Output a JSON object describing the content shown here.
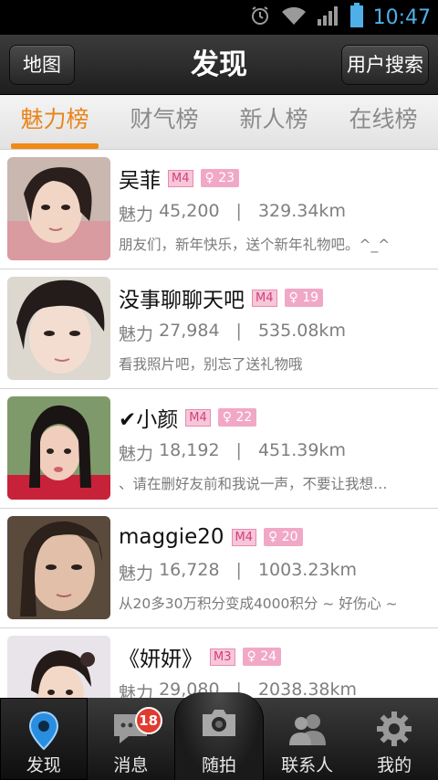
{
  "status_bar": {
    "time": "10:47"
  },
  "titlebar": {
    "title": "发现",
    "left_button": "地图",
    "right_button": "用户搜索"
  },
  "tabs": [
    {
      "label": "魅力榜",
      "active": true
    },
    {
      "label": "财气榜",
      "active": false
    },
    {
      "label": "新人榜",
      "active": false
    },
    {
      "label": "在线榜",
      "active": false
    }
  ],
  "users": [
    {
      "name": "吴菲",
      "level": "M4",
      "age": "23",
      "charm_label": "魅力",
      "charm": "45,200",
      "distance": "329.34km",
      "message": "朋友们，新年快乐，送个新年礼物吧。^_^"
    },
    {
      "name": "没事聊聊天吧",
      "level": "M4",
      "age": "19",
      "charm_label": "魅力",
      "charm": "27,984",
      "distance": "535.08km",
      "message": "看我照片吧，别忘了送礼物哦"
    },
    {
      "name": "✔小颜",
      "level": "M4",
      "age": "22",
      "charm_label": "魅力",
      "charm": "18,192",
      "distance": "451.39km",
      "message": "、请在删好友前和我说一声，不要让我想…"
    },
    {
      "name": "maggie20",
      "level": "M4",
      "age": "20",
      "charm_label": "魅力",
      "charm": "16,728",
      "distance": "1003.23km",
      "message": "从20多30万积分变成4000积分 ~ 好伤心 ~"
    },
    {
      "name": "《妍妍》",
      "level": "M3",
      "age": "24",
      "charm_label": "魅力",
      "charm": "29,080",
      "distance": "2038.38km",
      "message": ""
    }
  ],
  "bottom_nav": {
    "discover": "发现",
    "messages": "消息",
    "messages_badge": "18",
    "snap": "随拍",
    "contacts": "联系人",
    "mine": "我的"
  },
  "colors": {
    "accent": "#f08a14",
    "badge_red": "#e23a2e",
    "status_blue": "#4fb0e8"
  }
}
